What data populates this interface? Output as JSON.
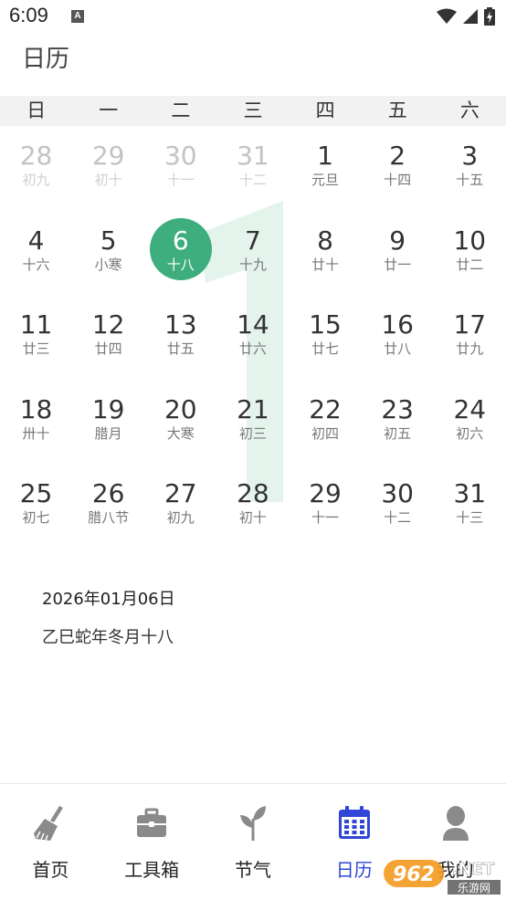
{
  "status": {
    "time": "6:09",
    "notif_letter": "A"
  },
  "title": "日历",
  "weekdays": [
    "日",
    "一",
    "二",
    "三",
    "四",
    "五",
    "六"
  ],
  "month_watermark": "1",
  "days": [
    {
      "num": "28",
      "lunar": "初九",
      "other": true
    },
    {
      "num": "29",
      "lunar": "初十",
      "other": true
    },
    {
      "num": "30",
      "lunar": "十一",
      "other": true
    },
    {
      "num": "31",
      "lunar": "十二",
      "other": true
    },
    {
      "num": "1",
      "lunar": "元旦"
    },
    {
      "num": "2",
      "lunar": "十四"
    },
    {
      "num": "3",
      "lunar": "十五"
    },
    {
      "num": "4",
      "lunar": "十六"
    },
    {
      "num": "5",
      "lunar": "小寒"
    },
    {
      "num": "6",
      "lunar": "十八",
      "selected": true
    },
    {
      "num": "7",
      "lunar": "十九"
    },
    {
      "num": "8",
      "lunar": "廿十"
    },
    {
      "num": "9",
      "lunar": "廿一"
    },
    {
      "num": "10",
      "lunar": "廿二"
    },
    {
      "num": "11",
      "lunar": "廿三"
    },
    {
      "num": "12",
      "lunar": "廿四"
    },
    {
      "num": "13",
      "lunar": "廿五"
    },
    {
      "num": "14",
      "lunar": "廿六"
    },
    {
      "num": "15",
      "lunar": "廿七"
    },
    {
      "num": "16",
      "lunar": "廿八"
    },
    {
      "num": "17",
      "lunar": "廿九"
    },
    {
      "num": "18",
      "lunar": "卅十"
    },
    {
      "num": "19",
      "lunar": "腊月"
    },
    {
      "num": "20",
      "lunar": "大寒"
    },
    {
      "num": "21",
      "lunar": "初三"
    },
    {
      "num": "22",
      "lunar": "初四"
    },
    {
      "num": "23",
      "lunar": "初五"
    },
    {
      "num": "24",
      "lunar": "初六"
    },
    {
      "num": "25",
      "lunar": "初七"
    },
    {
      "num": "26",
      "lunar": "腊八节"
    },
    {
      "num": "27",
      "lunar": "初九"
    },
    {
      "num": "28",
      "lunar": "初十"
    },
    {
      "num": "29",
      "lunar": "十一"
    },
    {
      "num": "30",
      "lunar": "十二"
    },
    {
      "num": "31",
      "lunar": "十三"
    }
  ],
  "selected_info": {
    "date": "2026年01月06日",
    "lunar": "乙巳蛇年冬月十八"
  },
  "tabs": [
    {
      "label": "首页",
      "icon": "broom-icon"
    },
    {
      "label": "工具箱",
      "icon": "toolbox-icon"
    },
    {
      "label": "节气",
      "icon": "sprout-icon"
    },
    {
      "label": "日历",
      "icon": "calendar-icon",
      "active": true
    },
    {
      "label": "我的",
      "icon": "user-icon"
    }
  ],
  "watermark": {
    "number": "962",
    "domain": ".NET",
    "site": "乐游网"
  },
  "colors": {
    "selected": "#3fae7e",
    "month_bg": "#e4f3ec",
    "tab_active": "#2f46d6",
    "icon_gray": "#8a8a8a"
  }
}
